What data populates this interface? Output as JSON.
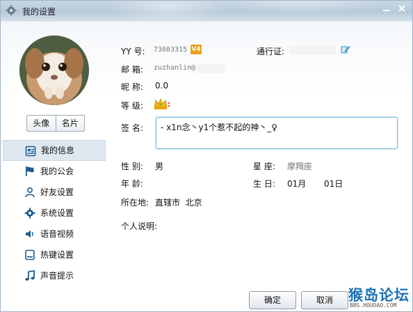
{
  "window": {
    "title": "我的设置",
    "icon": "gear-icon"
  },
  "sidebar": {
    "tabs": [
      {
        "label": "头像"
      },
      {
        "label": "名片"
      }
    ],
    "items": [
      {
        "label": "我的信息",
        "icon": "id-card-icon",
        "active": true
      },
      {
        "label": "我的公会",
        "icon": "flag-icon"
      },
      {
        "label": "好友设置",
        "icon": "person-icon"
      },
      {
        "label": "系统设置",
        "icon": "gear-icon"
      },
      {
        "label": "语音视频",
        "icon": "speaker-icon"
      },
      {
        "label": "热键设置",
        "icon": "keyboard-icon"
      },
      {
        "label": "声音提示",
        "icon": "music-note-icon"
      }
    ]
  },
  "profile": {
    "yy_label": "YY 号:",
    "yy_value": "73603315",
    "vip_badge": "V4",
    "passport_label": "通行证:",
    "email_label": "邮 箱:",
    "email_value": "zuzhanlin@",
    "nickname_label": "昵 称:",
    "nickname_value": "0.0",
    "level_label": "等 级:",
    "signature_label": "签 名:",
    "signature_value": "-    x1n念丶y1个惹不起的神丶_♀",
    "gender_label": "性 别:",
    "gender_value": "男",
    "zodiac_label": "星 座:",
    "zodiac_value": "摩羯座",
    "age_label": "年 龄:",
    "birthday_label": "生 日:",
    "birthday_month": "01月",
    "birthday_day": "01日",
    "location_label": "所在地:",
    "location_value": "直辖市  北京",
    "bio_label": "个人说明:"
  },
  "buttons": {
    "ok": "确定",
    "cancel": "取消"
  },
  "watermark": {
    "title": "猴岛论坛",
    "url": "BBS.HOUDAO.COM"
  },
  "colors": {
    "accent": "#1b72b7",
    "active_item_bg": "#dfe8f0",
    "input_border": "#7fb9d6"
  }
}
